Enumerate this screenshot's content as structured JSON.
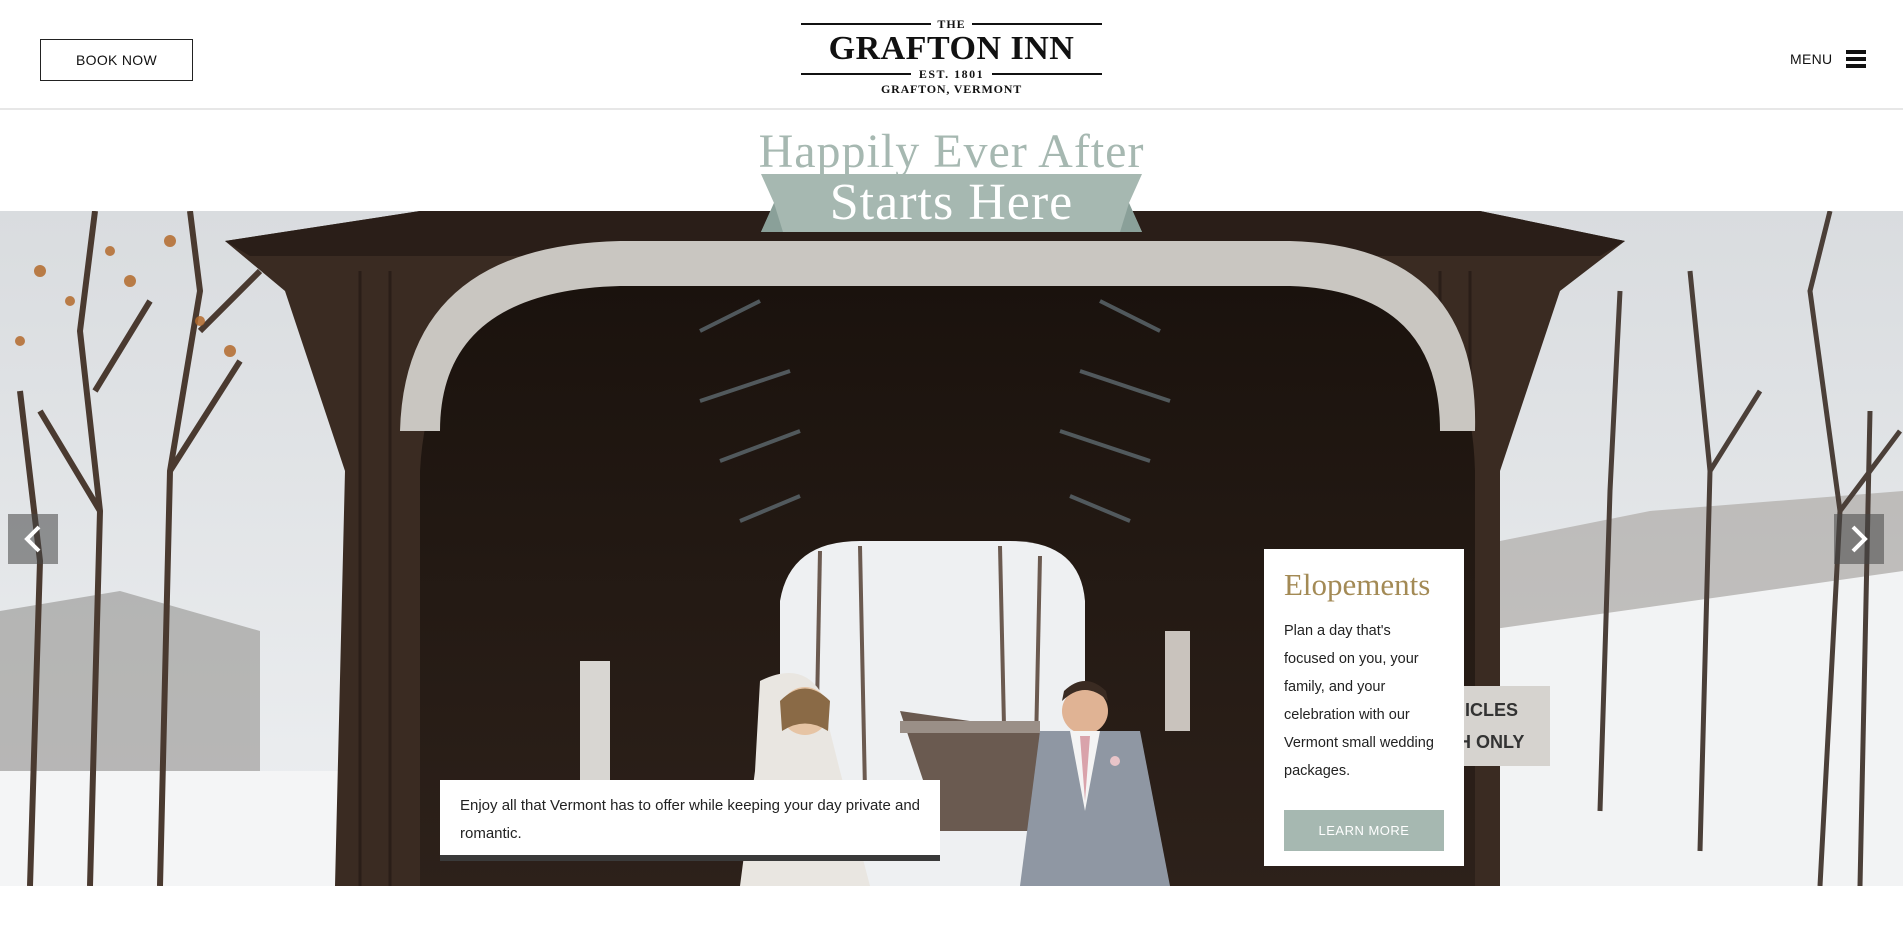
{
  "header": {
    "book_now_label": "BOOK NOW",
    "logo": {
      "the": "THE",
      "name": "GRAFTON INN",
      "est": "EST. 1801",
      "location": "GRAFTON, VERMONT"
    },
    "menu_label": "MENU"
  },
  "hero": {
    "headline_top": "Happily Ever After",
    "headline_ribbon": "Starts Here",
    "caption": "Enjoy all that Vermont has to offer while keeping your day private and romantic.",
    "card": {
      "title": "Elopements",
      "body": "Plan a day that's focused on you, your family, and your celebration with our Vermont small wedding packages.",
      "button_label": "LEARN MORE"
    },
    "sign_text_1": "ICLES",
    "sign_text_2": "H ONLY"
  },
  "colors": {
    "sage": "#a6b8b1",
    "gold": "#a38a55",
    "dark_wood": "#2a1e18",
    "header_border": "#e7e7e7"
  },
  "icons": {
    "prev": "chevron-left-icon",
    "next": "chevron-right-icon",
    "menu": "hamburger-icon"
  }
}
